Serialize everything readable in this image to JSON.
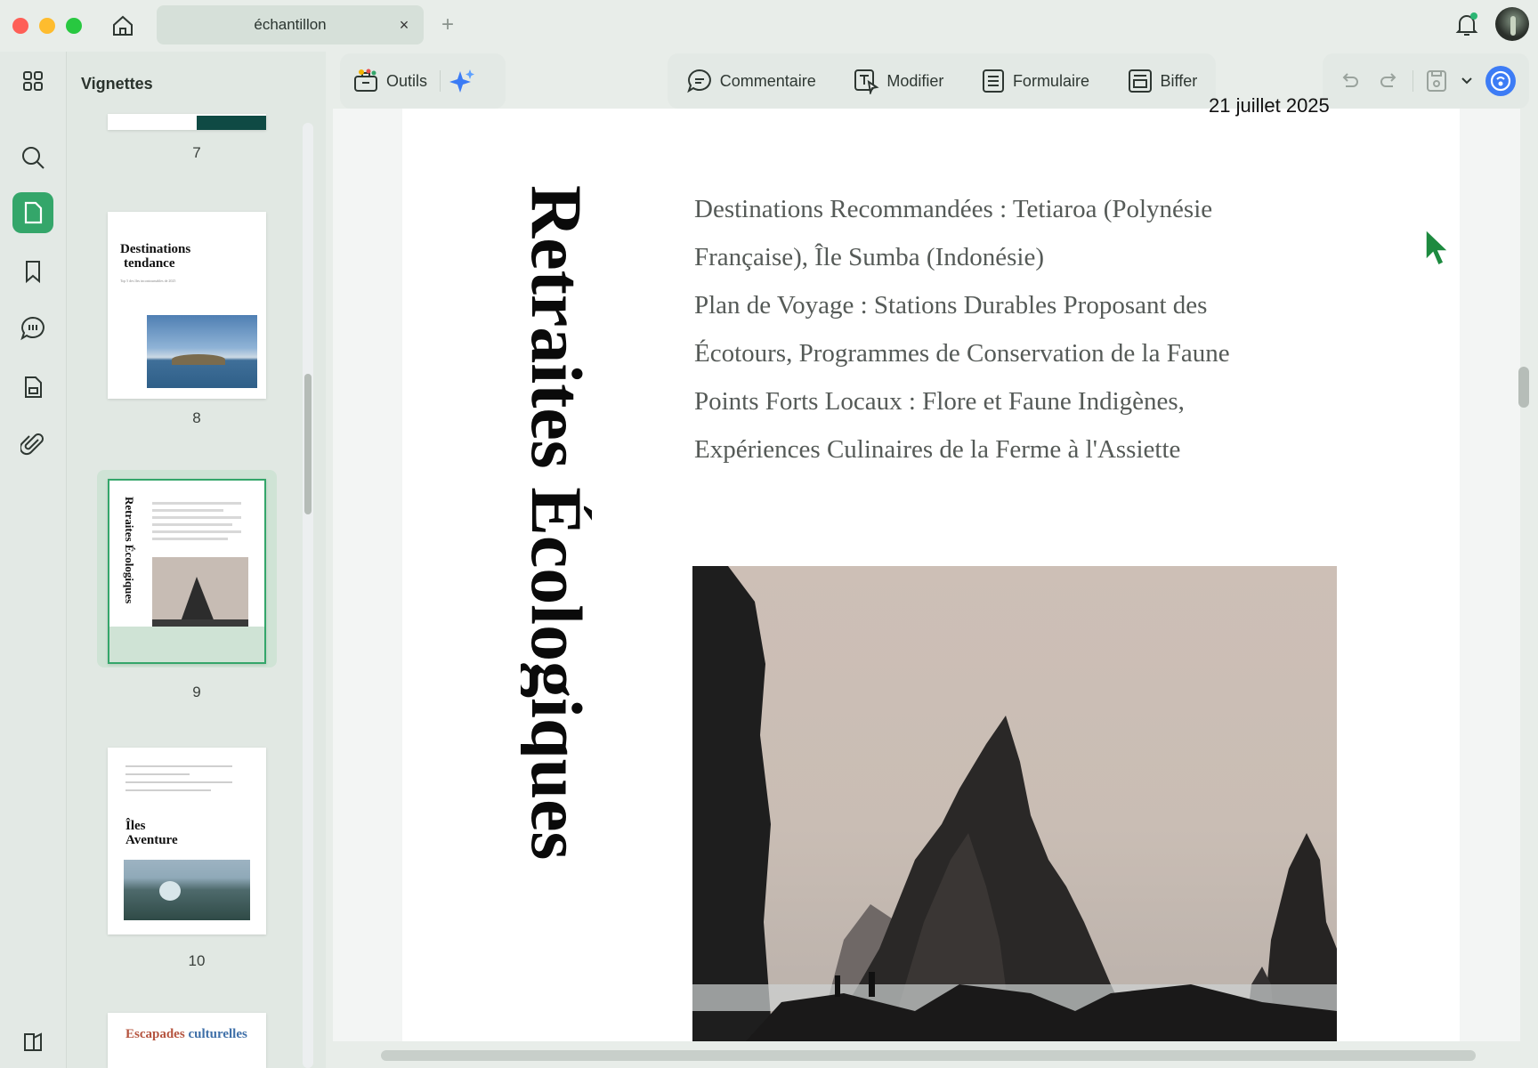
{
  "window": {
    "tab_title": "échantillon",
    "tab_close": "×",
    "new_tab": "+"
  },
  "sidebar": {
    "title": "Vignettes",
    "rail_icons": [
      "thumbnails-grid-icon",
      "search-icon",
      "page-icon",
      "bookmark-icon",
      "comment-icon",
      "form-icon",
      "attachment-icon",
      "sidebar-toggle-icon"
    ],
    "thumbnails": [
      {
        "number": "7"
      },
      {
        "number": "8",
        "title_line1": "Destinations",
        "title_line2": "tendance",
        "subtitle": "Top 5 des îles incontournables de 2025"
      },
      {
        "number": "9",
        "vertical": "Retraites Écologiques",
        "selected": true
      },
      {
        "number": "10",
        "title_line1": "Îles",
        "title_line2": "Aventure"
      },
      {
        "title_a": "Escapades",
        "title_b": "culturelles"
      }
    ]
  },
  "toolbar": {
    "tools_label": "Outils",
    "comment_label": "Commentaire",
    "edit_label": "Modifier",
    "form_label": "Formulaire",
    "redact_label": "Biffer"
  },
  "document": {
    "date": "21 juillet 2025",
    "vertical_title": "Retraites Écologiques",
    "lines": [
      "Destinations Recommandées : Tetiaroa (Polynésie",
      "Française), Île Sumba (Indonésie)",
      "Plan de Voyage : Stations Durables Proposant des",
      "Écotours, Programmes de Conservation de la Faune",
      "Points Forts Locaux : Flore et Faune Indigènes,",
      "Expériences Culinaires de la Ferme à l'Assiette"
    ]
  },
  "colors": {
    "accent": "#34a66a",
    "selected_bg": "#cfe3d5",
    "rail_bg": "#e3e9e5"
  }
}
